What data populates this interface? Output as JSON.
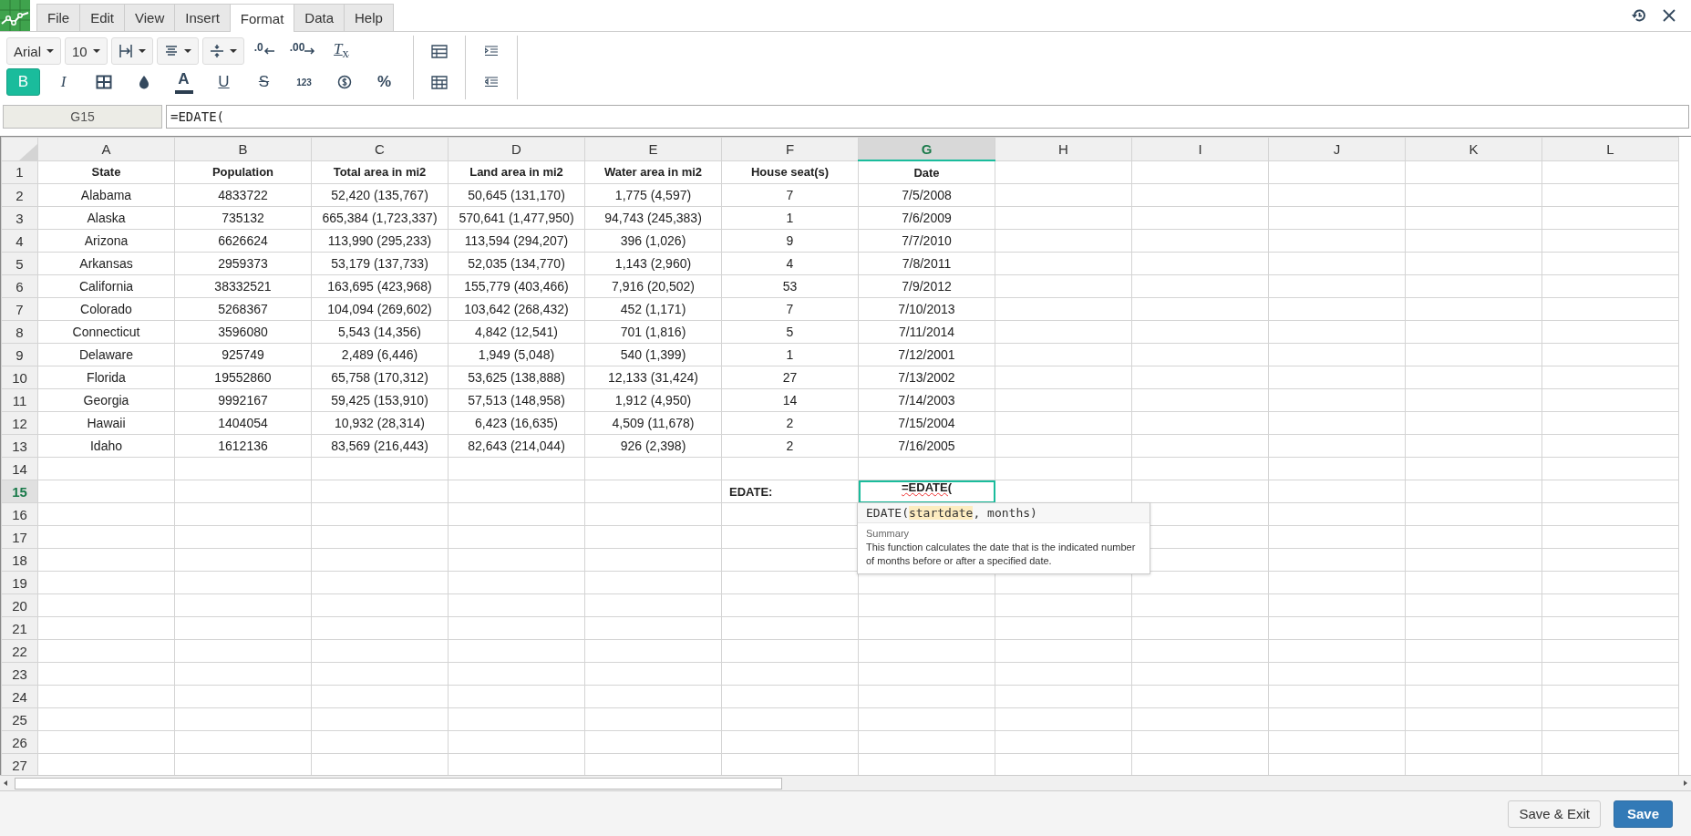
{
  "menu": [
    {
      "label": "File",
      "selected": false
    },
    {
      "label": "Edit",
      "selected": false
    },
    {
      "label": "View",
      "selected": false
    },
    {
      "label": "Insert",
      "selected": false
    },
    {
      "label": "Format",
      "selected": true
    },
    {
      "label": "Data",
      "selected": false
    },
    {
      "label": "Help",
      "selected": false
    }
  ],
  "toolbar": {
    "font": "Arial",
    "size": "10",
    "decrease_decimal": ".0",
    "increase_decimal": ".00",
    "clear_format": "*T*$_{x}$",
    "format_buttons": [
      {
        "kind": "bold",
        "label": "B",
        "selected": true
      },
      {
        "kind": "italic",
        "label": "I",
        "selected": false
      },
      {
        "kind": "borders"
      },
      {
        "kind": "fill"
      },
      {
        "kind": "color",
        "label": "A",
        "selected": false
      },
      {
        "kind": "underline",
        "label": "U",
        "selected": false
      },
      {
        "kind": "strike",
        "label": "S",
        "selected": false
      },
      {
        "kind": "number",
        "label": "123",
        "selected": false
      },
      {
        "kind": "currency"
      },
      {
        "kind": "percent",
        "label": "%",
        "selected": false
      }
    ]
  },
  "name_box": "G15",
  "formula": "=EDATE(",
  "columns": [
    {
      "label": "A",
      "selected": false
    },
    {
      "label": "B",
      "selected": false
    },
    {
      "label": "C",
      "selected": false
    },
    {
      "label": "D",
      "selected": false
    },
    {
      "label": "E",
      "selected": false
    },
    {
      "label": "F",
      "selected": false
    },
    {
      "label": "G",
      "selected": true
    },
    {
      "label": "H",
      "selected": false
    },
    {
      "label": "I",
      "selected": false
    },
    {
      "label": "J",
      "selected": false
    },
    {
      "label": "K",
      "selected": false
    },
    {
      "label": "L",
      "selected": false
    }
  ],
  "rows": [
    {
      "number": "1",
      "selected": false,
      "kind": "header",
      "cells": {
        "A": "State",
        "B": "Population",
        "C": "Total area in mi2",
        "D": "Land area in mi2",
        "E": "Water area in mi2",
        "F": "House seat(s)",
        "G": "Date"
      }
    },
    {
      "number": "2",
      "selected": false,
      "kind": "data",
      "cells": {
        "A": "Alabama",
        "B": "4833722",
        "C": "52,420 (135,767)",
        "D": "50,645 (131,170)",
        "E": "1,775 (4,597)",
        "F": "7",
        "G": "7/5/2008"
      }
    },
    {
      "number": "3",
      "selected": false,
      "kind": "data",
      "cells": {
        "A": "Alaska",
        "B": "735132",
        "C": "665,384 (1,723,337)",
        "D": "570,641 (1,477,950)",
        "E": "94,743 (245,383)",
        "F": "1",
        "G": "7/6/2009"
      }
    },
    {
      "number": "4",
      "selected": false,
      "kind": "data",
      "cells": {
        "A": "Arizona",
        "B": "6626624",
        "C": "113,990 (295,233)",
        "D": "113,594 (294,207)",
        "E": "396 (1,026)",
        "F": "9",
        "G": "7/7/2010"
      }
    },
    {
      "number": "5",
      "selected": false,
      "kind": "data",
      "cells": {
        "A": "Arkansas",
        "B": "2959373",
        "C": "53,179 (137,733)",
        "D": "52,035 (134,770)",
        "E": "1,143 (2,960)",
        "F": "4",
        "G": "7/8/2011"
      }
    },
    {
      "number": "6",
      "selected": false,
      "kind": "data",
      "cells": {
        "A": "California",
        "B": "38332521",
        "C": "163,695 (423,968)",
        "D": "155,779 (403,466)",
        "E": "7,916 (20,502)",
        "F": "53",
        "G": "7/9/2012"
      }
    },
    {
      "number": "7",
      "selected": false,
      "kind": "data",
      "cells": {
        "A": "Colorado",
        "B": "5268367",
        "C": "104,094 (269,602)",
        "D": "103,642 (268,432)",
        "E": "452 (1,171)",
        "F": "7",
        "G": "7/10/2013"
      }
    },
    {
      "number": "8",
      "selected": false,
      "kind": "data",
      "cells": {
        "A": "Connecticut",
        "B": "3596080",
        "C": "5,543 (14,356)",
        "D": "4,842 (12,541)",
        "E": "701 (1,816)",
        "F": "5",
        "G": "7/11/2014"
      }
    },
    {
      "number": "9",
      "selected": false,
      "kind": "data",
      "cells": {
        "A": "Delaware",
        "B": "925749",
        "C": "2,489 (6,446)",
        "D": "1,949 (5,048)",
        "E": "540 (1,399)",
        "F": "1",
        "G": "7/12/2001"
      }
    },
    {
      "number": "10",
      "selected": false,
      "kind": "data",
      "cells": {
        "A": "Florida",
        "B": "19552860",
        "C": "65,758 (170,312)",
        "D": "53,625 (138,888)",
        "E": "12,133 (31,424)",
        "F": "27",
        "G": "7/13/2002"
      }
    },
    {
      "number": "11",
      "selected": false,
      "kind": "data",
      "cells": {
        "A": "Georgia",
        "B": "9992167",
        "C": "59,425 (153,910)",
        "D": "57,513 (148,958)",
        "E": "1,912 (4,950)",
        "F": "14",
        "G": "7/14/2003"
      }
    },
    {
      "number": "12",
      "selected": false,
      "kind": "data",
      "cells": {
        "A": "Hawaii",
        "B": "1404054",
        "C": "10,932 (28,314)",
        "D": "6,423 (16,635)",
        "E": "4,509 (11,678)",
        "F": "2",
        "G": "7/15/2004"
      }
    },
    {
      "number": "13",
      "selected": false,
      "kind": "data",
      "cells": {
        "A": "Idaho",
        "B": "1612136",
        "C": "83,569 (216,443)",
        "D": "82,643 (214,044)",
        "E": "926 (2,398)",
        "F": "2",
        "G": "7/16/2005"
      }
    },
    {
      "number": "14",
      "selected": false,
      "kind": "data"
    },
    {
      "number": "15",
      "selected": true,
      "kind": "label",
      "cells": {
        "F": "EDATE:",
        "G": "=EDATE("
      }
    },
    {
      "number": "16",
      "selected": false,
      "kind": "data"
    },
    {
      "number": "17",
      "selected": false,
      "kind": "data"
    },
    {
      "number": "18",
      "selected": false,
      "kind": "data"
    },
    {
      "number": "19",
      "selected": false,
      "kind": "data"
    },
    {
      "number": "20",
      "selected": false,
      "kind": "data"
    },
    {
      "number": "21",
      "selected": false,
      "kind": "data"
    },
    {
      "number": "22",
      "selected": false,
      "kind": "data"
    },
    {
      "number": "23",
      "selected": false,
      "kind": "data"
    },
    {
      "number": "24",
      "selected": false,
      "kind": "data"
    },
    {
      "number": "25",
      "selected": false,
      "kind": "data"
    },
    {
      "number": "26",
      "selected": false,
      "kind": "data"
    },
    {
      "number": "27",
      "selected": false,
      "kind": "data"
    }
  ],
  "tooltip": {
    "signature": [
      {
        "text": "EDATE(",
        "highlighted": false
      },
      {
        "text": "startdate",
        "highlighted": true
      },
      {
        "text": ", months)",
        "highlighted": false
      }
    ],
    "heading": "Summary",
    "description": "This function calculates the date that is the indicated number of months before or after a specified date."
  },
  "buttons": [
    {
      "label": "Save & Exit",
      "kind": "secondary"
    },
    {
      "label": "Save",
      "kind": "primary"
    }
  ]
}
